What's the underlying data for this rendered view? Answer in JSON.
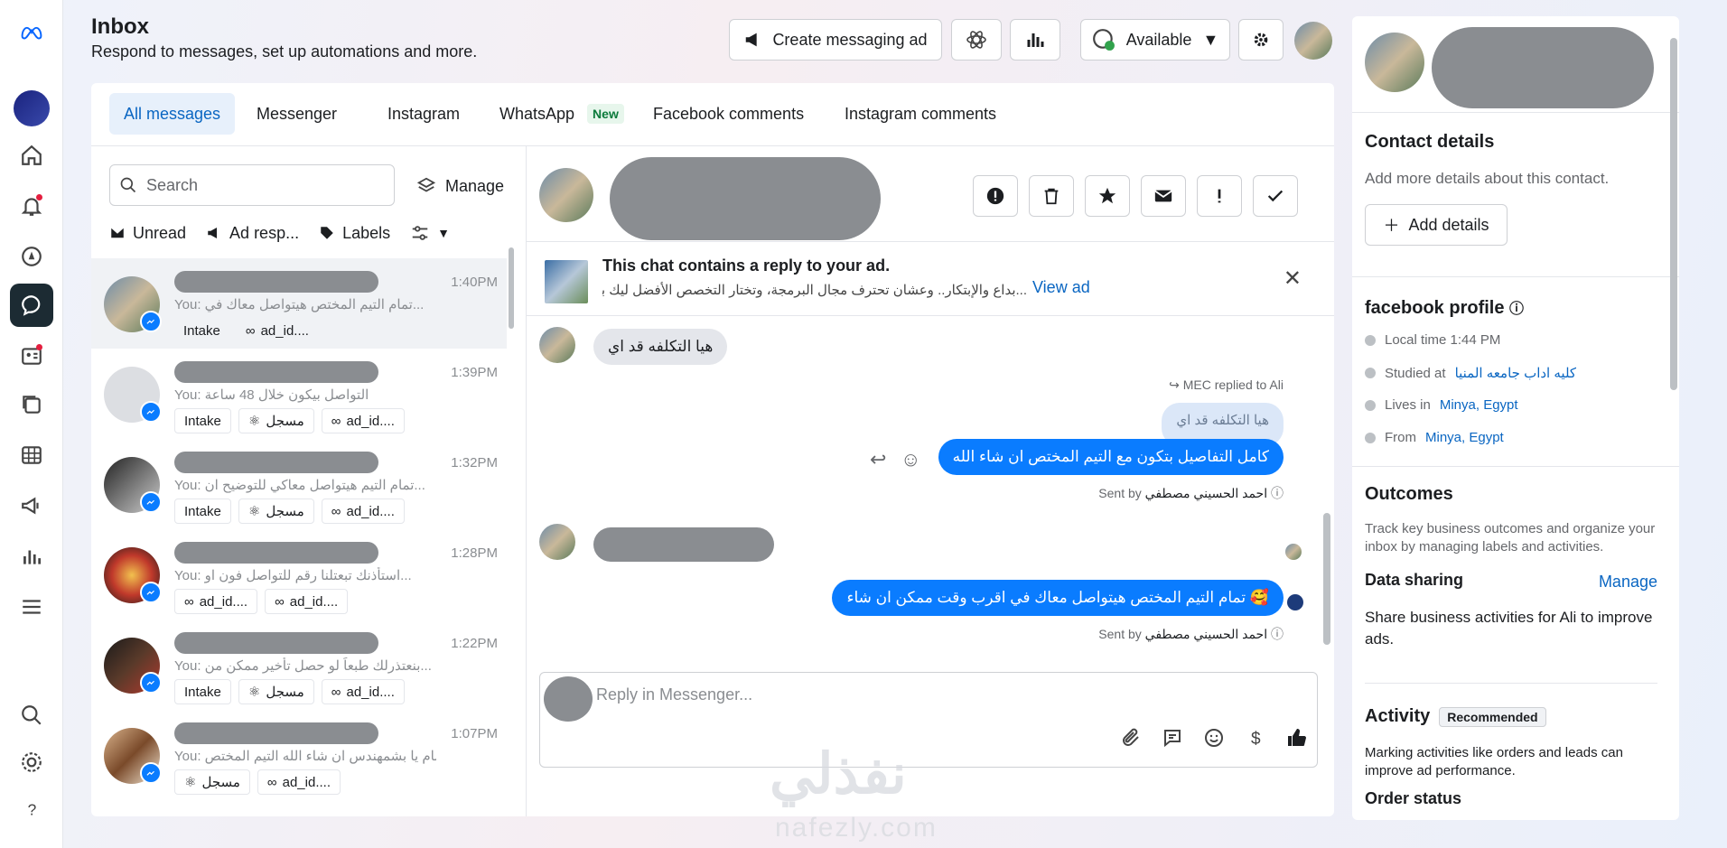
{
  "header": {
    "title": "Inbox",
    "subtitle": "Respond to messages, set up automations and more.",
    "create_ad_label": "Create messaging ad",
    "status_label": "Available"
  },
  "tabs": [
    {
      "label": "All messages"
    },
    {
      "label": "Messenger"
    },
    {
      "label": "Instagram"
    },
    {
      "label": "WhatsApp",
      "badge": "New"
    },
    {
      "label": "Facebook comments"
    },
    {
      "label": "Instagram comments"
    }
  ],
  "list": {
    "search_placeholder": "Search",
    "manage_label": "Manage",
    "filters": {
      "unread": "Unread",
      "ad": "Ad resp...",
      "labels": "Labels"
    },
    "conversations": [
      {
        "time": "1:40PM",
        "preview": "You: تمام التيم المختص هيتواصل معاك في...",
        "chips": [
          "Intake",
          "ad_id...."
        ]
      },
      {
        "time": "1:39PM",
        "preview": "You: التواصل بيكون خلال 48 ساعة",
        "chips": [
          "Intake",
          "مسجل",
          "ad_id...."
        ]
      },
      {
        "time": "1:32PM",
        "preview": "You: تمام التيم هيتواصل معاكي للتوضيح ان...",
        "chips": [
          "Intake",
          "مسجل",
          "ad_id...."
        ]
      },
      {
        "time": "1:28PM",
        "preview": "You: استأذنك تبعتلنا رقم للتواصل فون او...",
        "chips": [
          "ad_id....",
          "ad_id...."
        ]
      },
      {
        "time": "1:22PM",
        "preview": "You: بنعتذرلك طبعاً لو حصل تأخير ممكن من...",
        "chips": [
          "Intake",
          "مسجل",
          "ad_id...."
        ]
      },
      {
        "time": "1:07PM",
        "preview": "You: تمام يا بشمهندس ان شاء الله التيم المختص...",
        "chips": [
          "مسجل",
          "ad_id...."
        ]
      }
    ]
  },
  "chat": {
    "ad_title": "This chat contains a reply to your ad.",
    "ad_text": "...بداع والإبتكار.. وعشان تحترف مجال البرمجة، وتختار التخصص الأفضل ليك بين",
    "view_ad": "View ad",
    "msg_in_1": "هيا التكلفه قد اي",
    "replied_to": "MEC replied to Ali",
    "quoted": "هيا التكلفه قد اي",
    "msg_out_1": "كامل التفاصيل بتكون مع التيم المختص ان شاء الله",
    "sent_by_label": "Sent by",
    "sent_by_name": "احمد الحسيني مصطفي",
    "msg_out_2": "🥰 تمام التيم المختص هيتواصل معاك في اقرب وقت ممكن ان شاء",
    "reply_placeholder": "Reply in Messenger..."
  },
  "watermark": {
    "arabic": "نفذلي",
    "latin": "nafezly.com"
  },
  "right": {
    "contact_title": "Contact details",
    "contact_sub": "Add more details about this contact.",
    "add_details": "Add details",
    "profile_title": "facebook profile",
    "local_time": "Local time 1:44 PM",
    "studied_label": "Studied at",
    "studied_value": "كليه اداب جامعه المنيا",
    "lives_label": "Lives in",
    "lives_value": "Minya, Egypt",
    "from_label": "From",
    "from_value": "Minya, Egypt",
    "outcomes_title": "Outcomes",
    "outcomes_text": "Track key business outcomes and organize your inbox by managing labels and activities.",
    "data_sharing_title": "Data sharing",
    "data_sharing_manage": "Manage",
    "data_sharing_text": "Share business activities for Ali to improve ads.",
    "activity_title": "Activity",
    "activity_badge": "Recommended",
    "activity_text": "Marking activities like orders and leads can improve ad performance.",
    "order_status": "Order status"
  },
  "colors": {
    "accent": "#0a7cff",
    "link": "#0a66c2",
    "rail_active": "#1c2b33"
  }
}
